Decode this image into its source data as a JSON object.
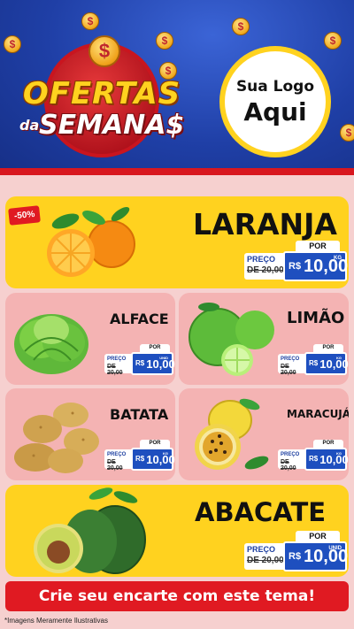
{
  "header": {
    "title_line1": "OFERTAS",
    "title_da": "da",
    "title_line2": "SEMANA$",
    "logo_line1": "Sua Logo",
    "logo_line2": "Aqui",
    "coin_symbol": "$"
  },
  "colors": {
    "header_blue": "#1f3fa6",
    "accent_red": "#e01a22",
    "card_yellow": "#ffd21f",
    "card_pink": "#f4b3b3",
    "price_blue": "#1e4fbf"
  },
  "products": [
    {
      "name": "LARANJA",
      "badge": "-50%",
      "por": "POR",
      "preco_label": "PREÇO",
      "old_price": "DE 20,00",
      "currency": "R$",
      "price": "10,00",
      "unit": "KG",
      "image": "orange-icon"
    },
    {
      "name": "ALFACE",
      "por": "POR",
      "preco_label": "PREÇO",
      "old_price": "DE 20,00",
      "currency": "R$",
      "price": "10,00",
      "unit": "UNID",
      "image": "lettuce-icon"
    },
    {
      "name": "LIMÃO",
      "por": "POR",
      "preco_label": "PREÇO",
      "old_price": "DE 20,00",
      "currency": "R$",
      "price": "10,00",
      "unit": "KG",
      "image": "lime-icon"
    },
    {
      "name": "BATATA",
      "por": "POR",
      "preco_label": "PREÇO",
      "old_price": "DE 20,00",
      "currency": "R$",
      "price": "10,00",
      "unit": "KG",
      "image": "potato-icon"
    },
    {
      "name": "MARACUJÁ",
      "por": "POR",
      "preco_label": "PREÇO",
      "old_price": "DE 20,00",
      "currency": "R$",
      "price": "10,00",
      "unit": "KG",
      "image": "passion-fruit-icon"
    },
    {
      "name": "ABACATE",
      "por": "POR",
      "preco_label": "PREÇO",
      "old_price": "DE 20,00",
      "currency": "R$",
      "price": "10,00",
      "unit": "UNID",
      "image": "avocado-icon"
    }
  ],
  "footer": {
    "cta": "Crie seu encarte com este tema!",
    "disclaimer": "*Imagens Meramente Ilustrativas"
  }
}
